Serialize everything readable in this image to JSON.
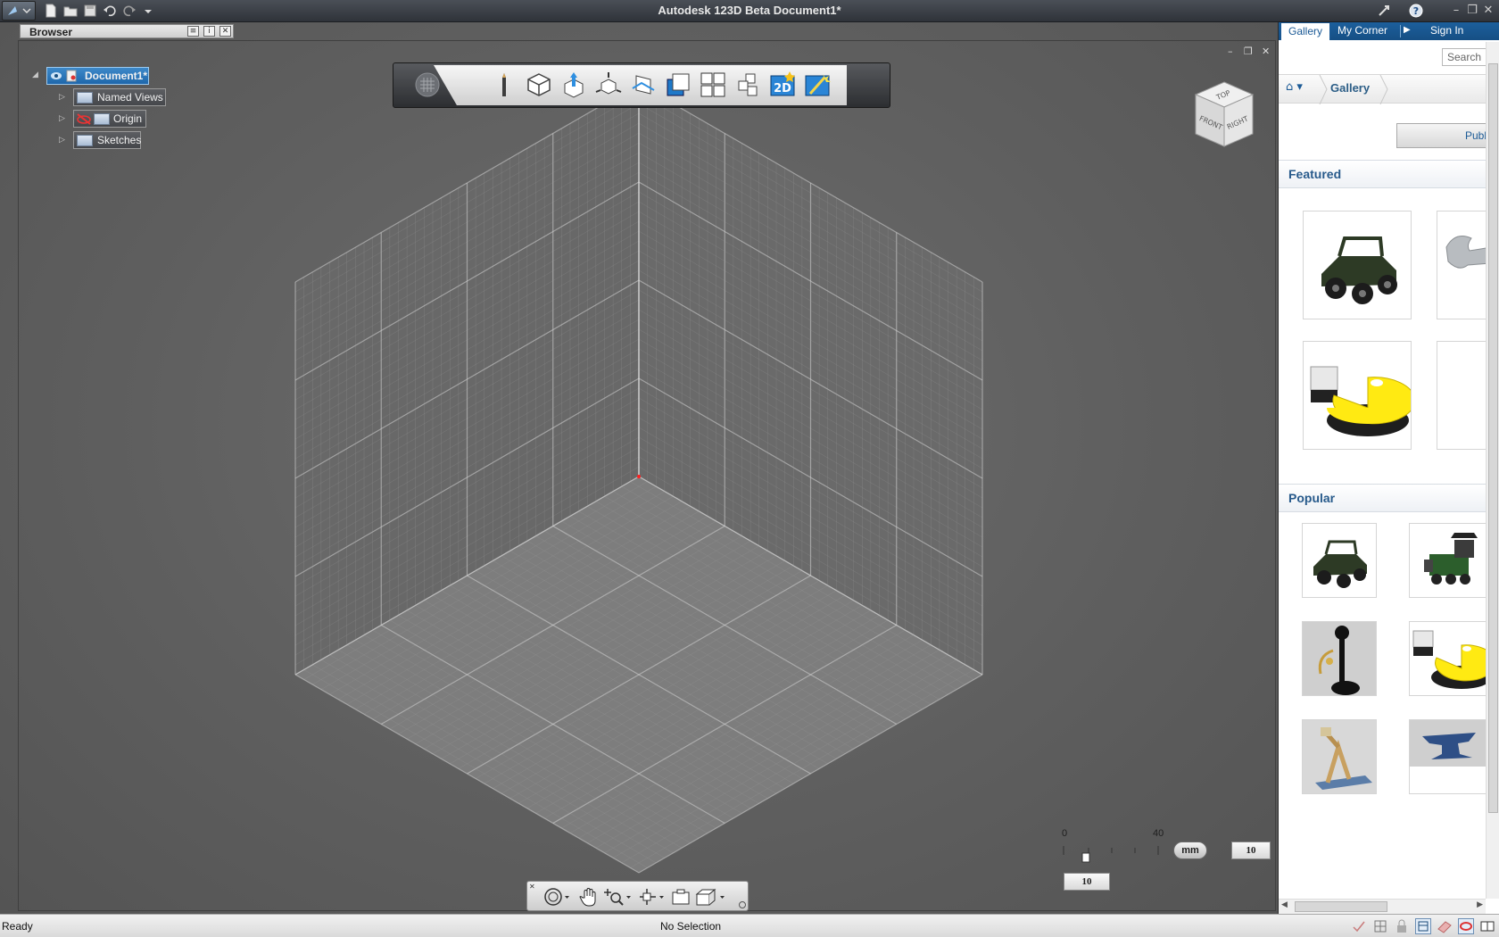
{
  "window": {
    "title": "Autodesk 123D Beta   Document1*"
  },
  "quick_access": [
    "new-icon",
    "open-icon",
    "save-icon",
    "undo-icon",
    "redo-icon",
    "customize-dropdown-icon"
  ],
  "browser": {
    "title": "Browser",
    "tree": [
      {
        "label": "Document1*",
        "icon": "document-icon",
        "selected": true
      },
      {
        "label": "Named Views",
        "icon": "folder-icon"
      },
      {
        "label": "Origin",
        "icon": "folder-icon"
      },
      {
        "label": "Sketches",
        "icon": "folder-icon"
      }
    ]
  },
  "toolbar": {
    "tools": [
      "primitives-icon",
      "sketch-icon",
      "construct-icon",
      "modify-icon",
      "pattern-icon",
      "grouping-icon",
      "combine-icon",
      "measure-icon",
      "text-icon",
      "snap-icon",
      "2d-drawing-icon",
      "materials-icon"
    ]
  },
  "viewcube": {
    "top": "TOP",
    "front": "FRONT",
    "right": "RIGHT"
  },
  "scale": {
    "min_label": "0",
    "max_label": "40",
    "unit": "mm",
    "grid_value": "10",
    "slider_value": "10"
  },
  "navbar": {
    "tools": [
      "orbit-icon",
      "pan-icon",
      "zoom-icon",
      "look-at-icon",
      "fit-icon",
      "view-style-icon"
    ]
  },
  "right_panel": {
    "tabs": [
      {
        "label": "Gallery",
        "active": true
      },
      {
        "label": "My Corner",
        "active": false
      },
      {
        "label": "Sign In",
        "active": false
      }
    ],
    "search_placeholder": "Search",
    "breadcrumb": "Gallery",
    "publish_label": "Publis",
    "featured_label": "Featured",
    "popular_label": "Popular",
    "featured_items": [
      "jeep-model",
      "wrench-model",
      "pacman-model",
      "empty-slot"
    ],
    "popular_items": [
      "jeep-model",
      "locomotive-model",
      "telephone-model",
      "pacman-model",
      "catapult-model",
      "anvil-model"
    ]
  },
  "status": {
    "left": "Ready",
    "center": "No Selection"
  },
  "colors": {
    "selection_blue": "#1f67ab",
    "panel_tab_blue": "#164f84",
    "section_text": "#275a8b",
    "origin_red": "#ff2020"
  }
}
